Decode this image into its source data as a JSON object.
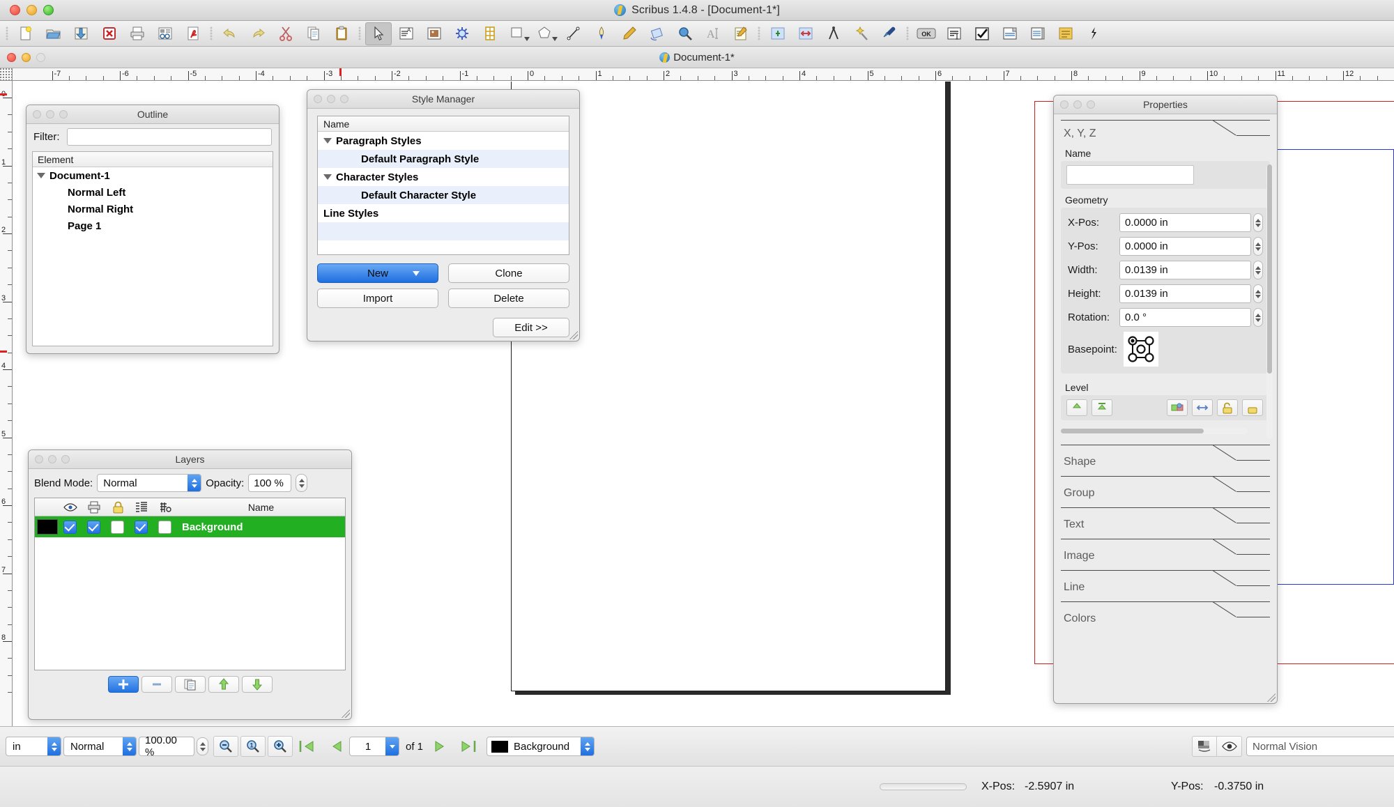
{
  "app": {
    "mac_window_title": "Scribus 1.4.8 - [Document-1*]",
    "doc_window_title": "Document-1*"
  },
  "toolbar": {
    "items": [
      {
        "name": "new-document",
        "icon": "page-new-icon"
      },
      {
        "name": "open-document",
        "icon": "folder-open-icon"
      },
      {
        "name": "save-document",
        "icon": "save-icon"
      },
      {
        "name": "close-document",
        "icon": "close-red-icon"
      },
      {
        "name": "print-document",
        "icon": "printer-icon"
      },
      {
        "name": "preflight-verifier",
        "icon": "preflight-icon"
      },
      {
        "name": "export-pdf",
        "icon": "pdf-icon"
      },
      {
        "name": "undo",
        "icon": "undo-arrow-icon"
      },
      {
        "name": "redo",
        "icon": "redo-arrow-icon"
      },
      {
        "name": "cut",
        "icon": "scissors-icon"
      },
      {
        "name": "copy",
        "icon": "copy-icon"
      },
      {
        "name": "paste",
        "icon": "clipboard-icon"
      },
      {
        "name": "select-item",
        "icon": "cursor-arrow-icon"
      },
      {
        "name": "insert-text-frame",
        "icon": "text-frame-icon"
      },
      {
        "name": "insert-image-frame",
        "icon": "image-frame-icon"
      },
      {
        "name": "insert-render-frame",
        "icon": "render-frame-icon"
      },
      {
        "name": "insert-table",
        "icon": "table-icon"
      },
      {
        "name": "insert-shape",
        "icon": "shape-icon"
      },
      {
        "name": "insert-polygon",
        "icon": "polygon-icon"
      },
      {
        "name": "insert-line",
        "icon": "line-icon"
      },
      {
        "name": "insert-bezier-curve",
        "icon": "bezier-pen-icon"
      },
      {
        "name": "freehand-line",
        "icon": "pencil-icon"
      },
      {
        "name": "rotate-item",
        "icon": "rotate-icon"
      },
      {
        "name": "zoom-tool",
        "icon": "magnifier-icon"
      },
      {
        "name": "edit-contents-of-frame",
        "icon": "edit-text-icon"
      },
      {
        "name": "edit-text-with-story-editor",
        "icon": "story-editor-icon"
      },
      {
        "name": "link-text-frames",
        "icon": "link-frames-icon"
      },
      {
        "name": "unlink-text-frames",
        "icon": "unlink-frames-icon"
      },
      {
        "name": "measurements",
        "icon": "compass-icon"
      },
      {
        "name": "copy-item-properties",
        "icon": "magic-wand-icon"
      },
      {
        "name": "eye-dropper",
        "icon": "eyedropper-icon"
      },
      {
        "name": "pdf-push-button",
        "icon": "ok-button-icon"
      },
      {
        "name": "pdf-text-field",
        "icon": "text-field-icon"
      },
      {
        "name": "pdf-check-box",
        "icon": "checkbox-icon"
      },
      {
        "name": "pdf-combo-box",
        "icon": "combo-box-icon"
      },
      {
        "name": "pdf-list-box",
        "icon": "list-box-icon"
      },
      {
        "name": "pdf-text-annotation",
        "icon": "annotation-icon"
      },
      {
        "name": "pdf-link-annotation",
        "icon": "link-annotation-icon"
      }
    ]
  },
  "rulers": {
    "unit": "in",
    "horizontal_labels": [
      "-7",
      "-6",
      "-5",
      "-4",
      "-3",
      "-2",
      "-1",
      "0",
      "1",
      "2",
      "3",
      "4",
      "5",
      "6",
      "7",
      "8",
      "9",
      "10",
      "11",
      "12"
    ],
    "vertical_labels": [
      "0",
      "1",
      "2",
      "3",
      "4",
      "5",
      "6",
      "7",
      "8"
    ]
  },
  "outline": {
    "title": "Outline",
    "filter_label": "Filter:",
    "filter_value": "",
    "filter_placeholder": "",
    "column_header": "Element",
    "tree": [
      {
        "label": "Document-1",
        "level": 0,
        "expanded": true
      },
      {
        "label": "Normal Left",
        "level": 1,
        "expanded": false
      },
      {
        "label": "Normal Right",
        "level": 1,
        "expanded": false
      },
      {
        "label": "Page 1",
        "level": 1,
        "expanded": false
      }
    ]
  },
  "style_manager": {
    "title": "Style Manager",
    "column_header": "Name",
    "rows": [
      {
        "label": "Paragraph Styles",
        "level": 0,
        "expanded": true,
        "alt": false
      },
      {
        "label": "Default Paragraph Style",
        "level": 1,
        "expanded": false,
        "alt": true
      },
      {
        "label": "Character Styles",
        "level": 0,
        "expanded": true,
        "alt": false
      },
      {
        "label": "Default Character Style",
        "level": 1,
        "expanded": false,
        "alt": true
      },
      {
        "label": "Line Styles",
        "level": 0,
        "expanded": false,
        "alt": false
      },
      {
        "label": "",
        "level": 0,
        "expanded": false,
        "alt": true
      },
      {
        "label": "",
        "level": 0,
        "expanded": false,
        "alt": false
      },
      {
        "label": "",
        "level": 0,
        "expanded": false,
        "alt": true
      }
    ],
    "buttons": {
      "new": "New",
      "clone": "Clone",
      "import": "Import",
      "delete": "Delete",
      "edit": "Edit >>"
    }
  },
  "layers": {
    "title": "Layers",
    "blend_mode_label": "Blend Mode:",
    "blend_mode_value": "Normal",
    "opacity_label": "Opacity:",
    "opacity_value": "100 %",
    "columns": [
      {
        "name": "layer-color-swatch",
        "icon": ""
      },
      {
        "name": "visible-column",
        "icon": "eye-icon"
      },
      {
        "name": "print-column",
        "icon": "printer-icon"
      },
      {
        "name": "lock-column",
        "icon": "lock-icon"
      },
      {
        "name": "text-flow-column",
        "icon": "text-flow-icon"
      },
      {
        "name": "outline-column",
        "icon": "outline-mode-icon"
      },
      {
        "name": "name-column",
        "label": "Name"
      }
    ],
    "name_header": "Name",
    "rows": [
      {
        "color": "#000000",
        "visible": true,
        "print": true,
        "lock": false,
        "flow": true,
        "outline": false,
        "name": "Background",
        "selected": true,
        "row_color": "#22b022"
      }
    ],
    "footer_buttons": [
      {
        "name": "add-layer-button",
        "icon": "plus-icon",
        "primary": true
      },
      {
        "name": "remove-layer-button",
        "icon": "minus-icon",
        "primary": false
      },
      {
        "name": "duplicate-layer-button",
        "icon": "duplicate-icon",
        "primary": false
      },
      {
        "name": "raise-layer-button",
        "icon": "arrow-up-icon",
        "primary": false
      },
      {
        "name": "lower-layer-button",
        "icon": "arrow-down-icon",
        "primary": false
      }
    ]
  },
  "properties": {
    "title": "Properties",
    "tabs": [
      {
        "label": "X, Y, Z",
        "expanded": true
      },
      {
        "label": "Shape",
        "expanded": false
      },
      {
        "label": "Group",
        "expanded": false
      },
      {
        "label": "Text",
        "expanded": false
      },
      {
        "label": "Image",
        "expanded": false
      },
      {
        "label": "Line",
        "expanded": false
      },
      {
        "label": "Colors",
        "expanded": false
      }
    ],
    "name_section_label": "Name",
    "name_value": "",
    "geometry_label": "Geometry",
    "geometry": [
      {
        "label": "X-Pos:",
        "value": "0.0000 in"
      },
      {
        "label": "Y-Pos:",
        "value": "0.0000 in"
      },
      {
        "label": "Width:",
        "value": "0.0139 in"
      },
      {
        "label": "Height:",
        "value": "0.0139 in"
      },
      {
        "label": "Rotation:",
        "value": "0.0 °"
      }
    ],
    "basepoint_label": "Basepoint:",
    "level_label": "Level"
  },
  "statusbar": {
    "unit_value": "in",
    "preview_mode_value": "Normal",
    "zoom_value": "100.00 %",
    "page_number": "1",
    "of_text": "of 1",
    "layer_value": "Background",
    "layer_color": "#000000",
    "vision_value": "Normal Vision",
    "buttons": [
      {
        "name": "zoom-out-button",
        "icon": "zoom-out-icon"
      },
      {
        "name": "zoom-100-button",
        "icon": "zoom-100-icon"
      },
      {
        "name": "zoom-in-button",
        "icon": "zoom-in-icon"
      },
      {
        "name": "first-page-button",
        "icon": "first-page-icon"
      },
      {
        "name": "previous-page-button",
        "icon": "previous-page-icon"
      },
      {
        "name": "next-page-button",
        "icon": "next-page-icon"
      },
      {
        "name": "last-page-button",
        "icon": "last-page-icon"
      },
      {
        "name": "cms-toggle-button",
        "icon": "color-management-icon"
      },
      {
        "name": "preview-toggle-button",
        "icon": "eye-icon"
      }
    ]
  },
  "coordbar": {
    "x_pos_label": "X-Pos:",
    "x_pos_value": "-2.5907 in",
    "y_pos_label": "Y-Pos:",
    "y_pos_value": "-0.3750 in"
  }
}
